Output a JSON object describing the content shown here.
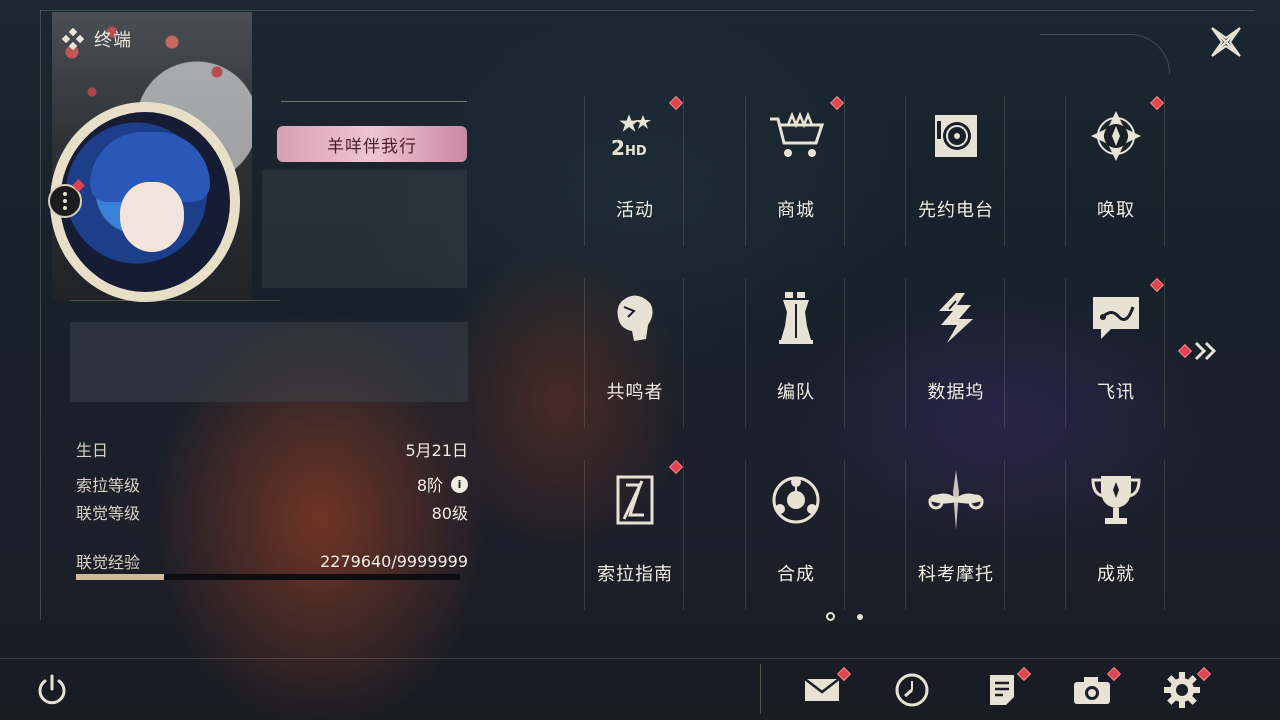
{
  "header": {
    "title": "终端"
  },
  "profile": {
    "nickname": "羊咩伴我行",
    "stats": [
      {
        "label": "生日",
        "value": "5月21日"
      },
      {
        "label": "索拉等级",
        "value": "8阶"
      },
      {
        "label": "联觉等级",
        "value": "80级"
      }
    ],
    "exp": {
      "label": "联觉经验",
      "value": "2279640/9999999",
      "progress": 0.228
    }
  },
  "menu": {
    "items": [
      {
        "label": "活动",
        "icon": "event-icon",
        "badge": true
      },
      {
        "label": "商城",
        "icon": "shop-cart-icon",
        "badge": true
      },
      {
        "label": "先约电台",
        "icon": "radio-icon",
        "badge": false
      },
      {
        "label": "唤取",
        "icon": "gacha-compass-icon",
        "badge": true
      },
      {
        "label": "共鸣者",
        "icon": "resonator-head-icon",
        "badge": false
      },
      {
        "label": "编队",
        "icon": "chess-team-icon",
        "badge": false
      },
      {
        "label": "数据坞",
        "icon": "data-bank-icon",
        "badge": false
      },
      {
        "label": "飞讯",
        "icon": "message-chat-icon",
        "badge": true
      },
      {
        "label": "索拉指南",
        "icon": "guide-book-icon",
        "badge": true
      },
      {
        "label": "合成",
        "icon": "synthesis-icon",
        "badge": false
      },
      {
        "label": "科考摩托",
        "icon": "motorbike-icon",
        "badge": false
      },
      {
        "label": "成就",
        "icon": "trophy-icon",
        "badge": false
      }
    ],
    "page": 1,
    "page_count": 2
  },
  "bottom_bar": {
    "buttons": [
      {
        "name": "mail-icon",
        "badge": true
      },
      {
        "name": "clock-icon",
        "badge": false
      },
      {
        "name": "notice-icon",
        "badge": true
      },
      {
        "name": "camera-icon",
        "badge": true
      },
      {
        "name": "settings-gear-icon",
        "badge": true
      }
    ]
  },
  "colors": {
    "badge": "#e0454f",
    "accent_gold": "#cdbb97",
    "nameplate_pink": "#f0c3d2"
  }
}
